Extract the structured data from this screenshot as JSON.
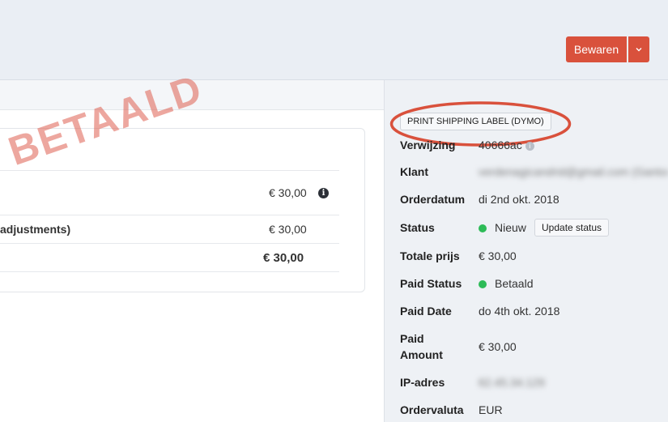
{
  "header": {
    "save_label": "Bewaren"
  },
  "order_table": {
    "rows": [
      {
        "amount": "€ 30,00"
      },
      {
        "label": "adjustments)",
        "amount": "€ 30,00"
      },
      {
        "amount": "€ 30,00"
      }
    ]
  },
  "stamp": {
    "text": "BETAALD",
    "color": "#de5f50"
  },
  "actions": {
    "print_label": "PRINT SHIPPING LABEL (DYMO)",
    "update_status_label": "Update status"
  },
  "details": {
    "reference_label": "Verwijzing",
    "reference_value": "40666ac",
    "customer_label": "Klant",
    "customer_value": "verdenagicandrid@gmail.com (Ganton)",
    "order_date_label": "Orderdatum",
    "order_date_value": "di 2nd okt. 2018",
    "status_label": "Status",
    "status_value": "Nieuw",
    "total_label": "Totale prijs",
    "total_value": "€ 30,00",
    "paid_status_label": "Paid Status",
    "paid_status_value": "Betaald",
    "paid_date_label": "Paid Date",
    "paid_date_value": "do 4th okt. 2018",
    "paid_amount_label_1": "Paid",
    "paid_amount_label_2": "Amount",
    "paid_amount_value": "€ 30,00",
    "ip_label": "IP-adres",
    "ip_value": "62.45.34.129",
    "currency_label": "Ordervaluta",
    "currency_value": "EUR"
  },
  "colors": {
    "accent": "#d9513c",
    "status_green": "#2dbb57",
    "highlight_ring": "#d9513c"
  }
}
